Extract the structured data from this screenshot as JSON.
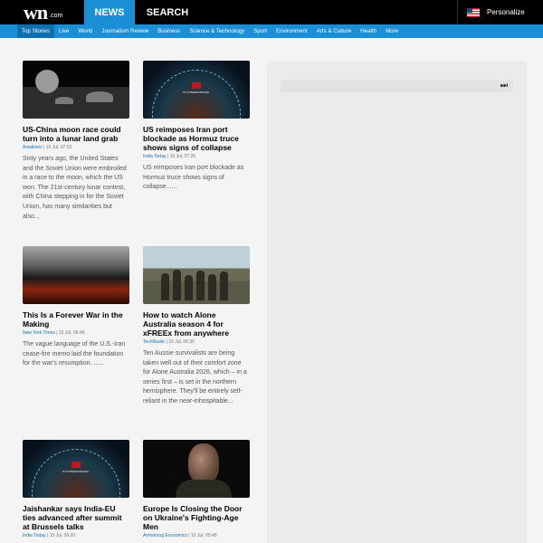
{
  "header": {
    "logo_main": "wn",
    "logo_suffix": ".com",
    "tabs": [
      "NEWS",
      "SEARCH"
    ],
    "personalize": "Personalize",
    "flag_icon": "us-flag-icon"
  },
  "nav": [
    "Top Stories",
    "Live",
    "World",
    "Journalism Review",
    "Business",
    "Science & Technology",
    "Sport",
    "Environment",
    "Arts & Culture",
    "Health",
    "More"
  ],
  "articles": [
    {
      "headline": "US-China moon race could turn into a lunar land grab",
      "source": "Asiatimes",
      "time": "15 Jul, 07:52",
      "summary": "Sixty years ago, the United States and the Soviet Union were embroiled in a race to the moon, which the US won. The 21st-century lunar contest, with China stepping in for the Soviet Union, has many similarities but also..."
    },
    {
      "headline": "US reimposes Iran port blockade as Hormuz truce shows signs of collapse",
      "source": "India Today",
      "time": "15 Jul, 07:26",
      "summary": "US reimposes Iran port blockade as Hormuz truce shows signs of collapse......"
    },
    {
      "headline": "This Is a Forever War in the Making",
      "source": "New York Times",
      "time": "15 Jul, 06:49",
      "summary": "The vague language of the U.S.-Iran cease-fire memo laid the foundation for the war's resumption. ......"
    },
    {
      "headline": "How to watch Alone Australia season 4 for xFREEx from anywhere",
      "source": "TechRadar",
      "time": "15 Jul, 06:30",
      "summary": "Ten Aussie survivalists are being taken well out of their comfort zone for Alone Australia 2026, which – in a series first – is set in the northern hemisphere. They'll be entirely self-reliant in the near-inhospitable..."
    },
    {
      "headline": "Jaishankar says India-EU ties advanced after summit at Brussels talks",
      "source": "India Today",
      "time": "15 Jul, 06:20",
      "summary": ""
    },
    {
      "headline": "Europe Is Closing the Door on Ukraine's Fighting-Age Men",
      "source": "Armstrong Economics",
      "time": "15 Jul, 05:48",
      "summary": ""
    }
  ],
  "thumb_caption": "ITV INTERNATIONAL",
  "panel": {
    "control_icon": "fast-forward-icon",
    "control_glyph": "⏭"
  },
  "colors": {
    "accent": "#1a8fd6",
    "topbar": "#000000"
  }
}
